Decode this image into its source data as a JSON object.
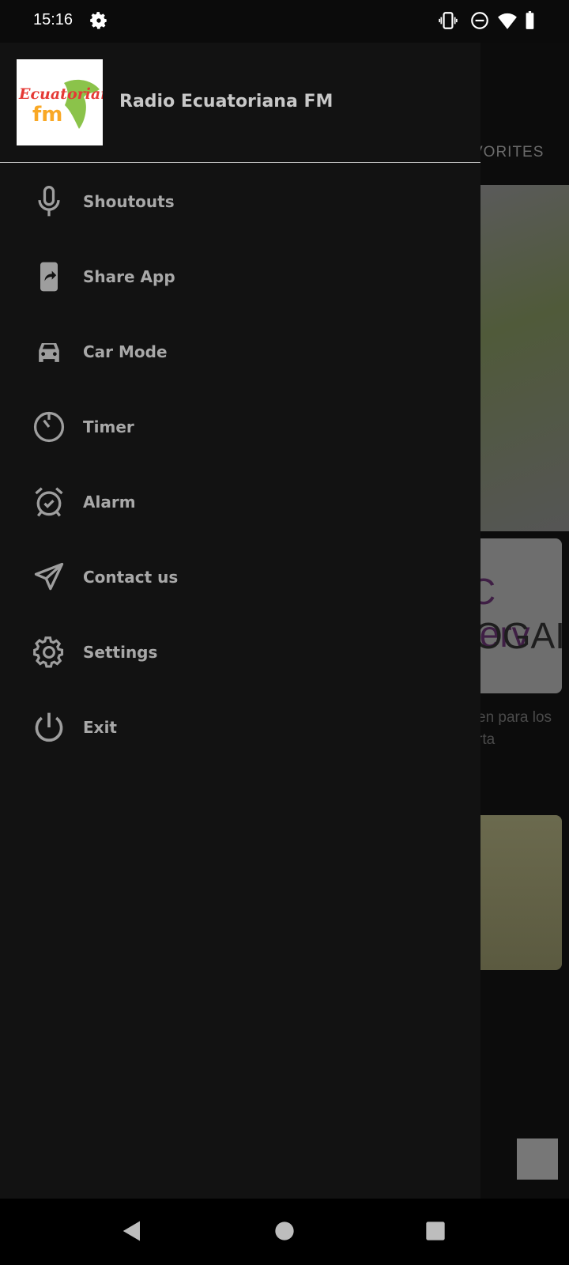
{
  "status_bar": {
    "time": "15:16"
  },
  "drawer": {
    "app_title": "Radio Ecuatoriana FM",
    "items": [
      {
        "label": "Shoutouts",
        "icon": "microphone-icon"
      },
      {
        "label": "Share App",
        "icon": "share-app-icon"
      },
      {
        "label": "Car Mode",
        "icon": "car-icon"
      },
      {
        "label": "Timer",
        "icon": "timer-icon"
      },
      {
        "label": "Alarm",
        "icon": "alarm-icon"
      },
      {
        "label": "Contact us",
        "icon": "send-icon"
      },
      {
        "label": "Settings",
        "icon": "gear-icon"
      },
      {
        "label": "Exit",
        "icon": "power-icon"
      }
    ]
  },
  "background": {
    "tab_partial": "VORITES",
    "card1_line1": "C ferv",
    "card1_line2": "OGAI",
    "desc_line1": "en para los",
    "desc_line2": "rta"
  },
  "colors": {
    "drawer_bg": "#121212",
    "label": "#a8a8a8",
    "icon": "#9e9e9e"
  }
}
